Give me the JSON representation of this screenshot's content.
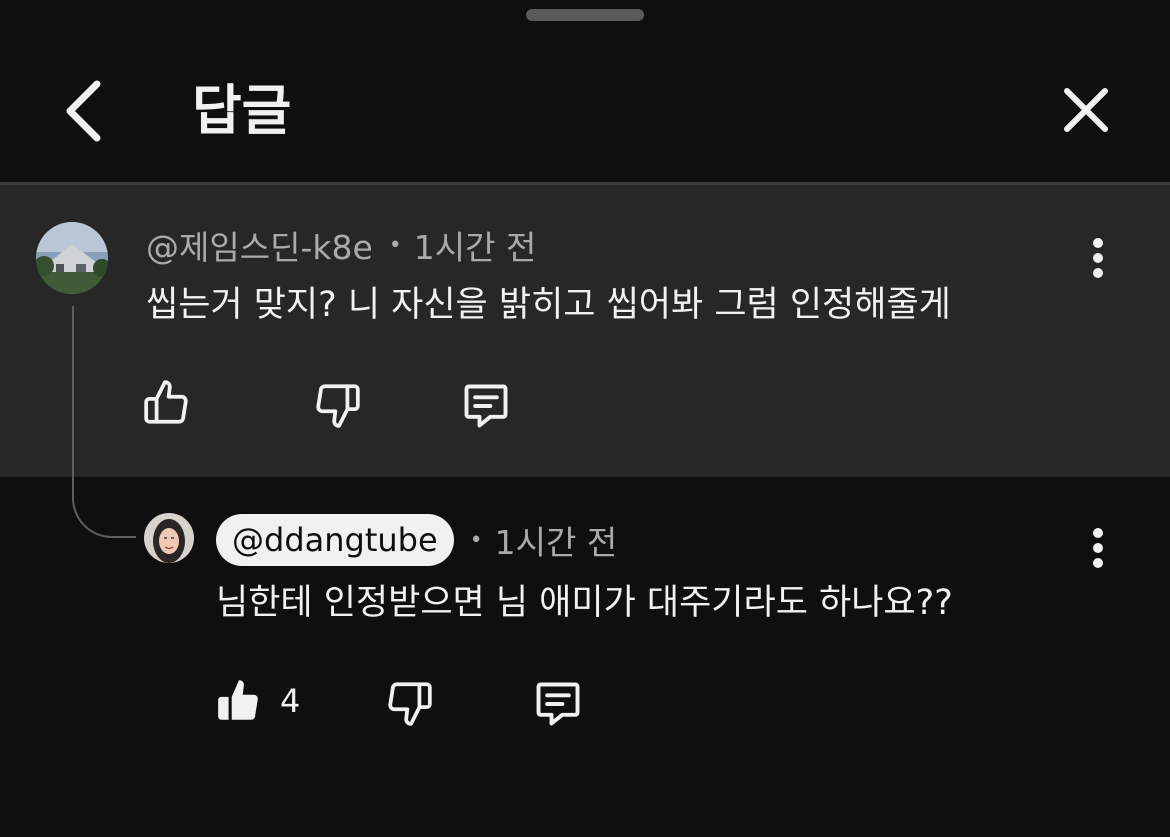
{
  "header": {
    "title": "답글",
    "back_icon": "chevron-left-icon",
    "close_icon": "close-icon"
  },
  "parent_comment": {
    "author": "@제임스딘-k8e",
    "separator": "•",
    "time": "1시간 전",
    "text": "씹는거 맞지? 니 자신을  밝히고 씹어봐 그럼 인정해줄게",
    "like_count": "",
    "actions": [
      "thumbs-up-icon",
      "thumbs-down-icon",
      "reply-icon"
    ]
  },
  "reply": {
    "author": "@ddangtube",
    "separator": "•",
    "time": "1시간 전",
    "text": "님한테 인정받으면 님 애미가 대주기라도 하나요??",
    "like_count": "4",
    "liked": true,
    "actions": [
      "thumbs-up-filled-icon",
      "thumbs-down-icon",
      "reply-icon"
    ]
  },
  "colors": {
    "background": "#0f0f0f",
    "highlight": "#272727",
    "text_primary": "#f1f1f1",
    "text_secondary": "#aaaaaa"
  }
}
